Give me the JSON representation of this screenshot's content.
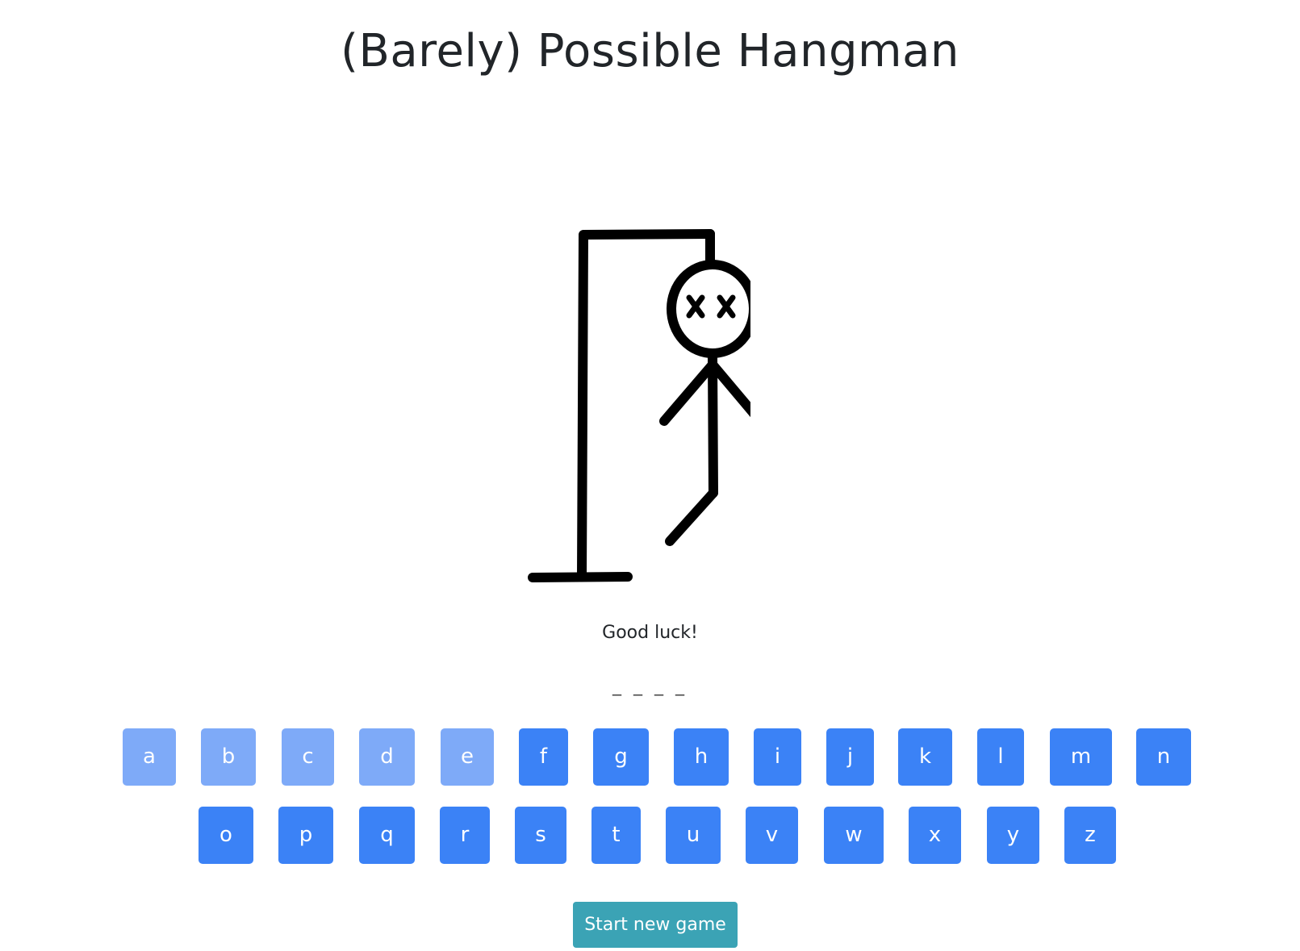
{
  "title": "(Barely) Possible Hangman",
  "message": "Good luck!",
  "word_display": "_ _ _ _",
  "keyboard": {
    "row1": [
      {
        "letter": "a",
        "used": true
      },
      {
        "letter": "b",
        "used": true
      },
      {
        "letter": "c",
        "used": true
      },
      {
        "letter": "d",
        "used": true
      },
      {
        "letter": "e",
        "used": true
      },
      {
        "letter": "f",
        "used": false
      },
      {
        "letter": "g",
        "used": false
      },
      {
        "letter": "h",
        "used": false
      },
      {
        "letter": "i",
        "used": false
      },
      {
        "letter": "j",
        "used": false
      },
      {
        "letter": "k",
        "used": false
      },
      {
        "letter": "l",
        "used": false
      },
      {
        "letter": "m",
        "used": false
      },
      {
        "letter": "n",
        "used": false
      }
    ],
    "row2": [
      {
        "letter": "o",
        "used": false
      },
      {
        "letter": "p",
        "used": false
      },
      {
        "letter": "q",
        "used": false
      },
      {
        "letter": "r",
        "used": false
      },
      {
        "letter": "s",
        "used": false
      },
      {
        "letter": "t",
        "used": false
      },
      {
        "letter": "u",
        "used": false
      },
      {
        "letter": "v",
        "used": false
      },
      {
        "letter": "w",
        "used": false
      },
      {
        "letter": "x",
        "used": false
      },
      {
        "letter": "y",
        "used": false
      },
      {
        "letter": "z",
        "used": false
      }
    ]
  },
  "start_button_label": "Start new game",
  "colors": {
    "key_active": "#3b82f6",
    "key_used": "#7eaaf8",
    "start_button": "#3ba3b5"
  }
}
